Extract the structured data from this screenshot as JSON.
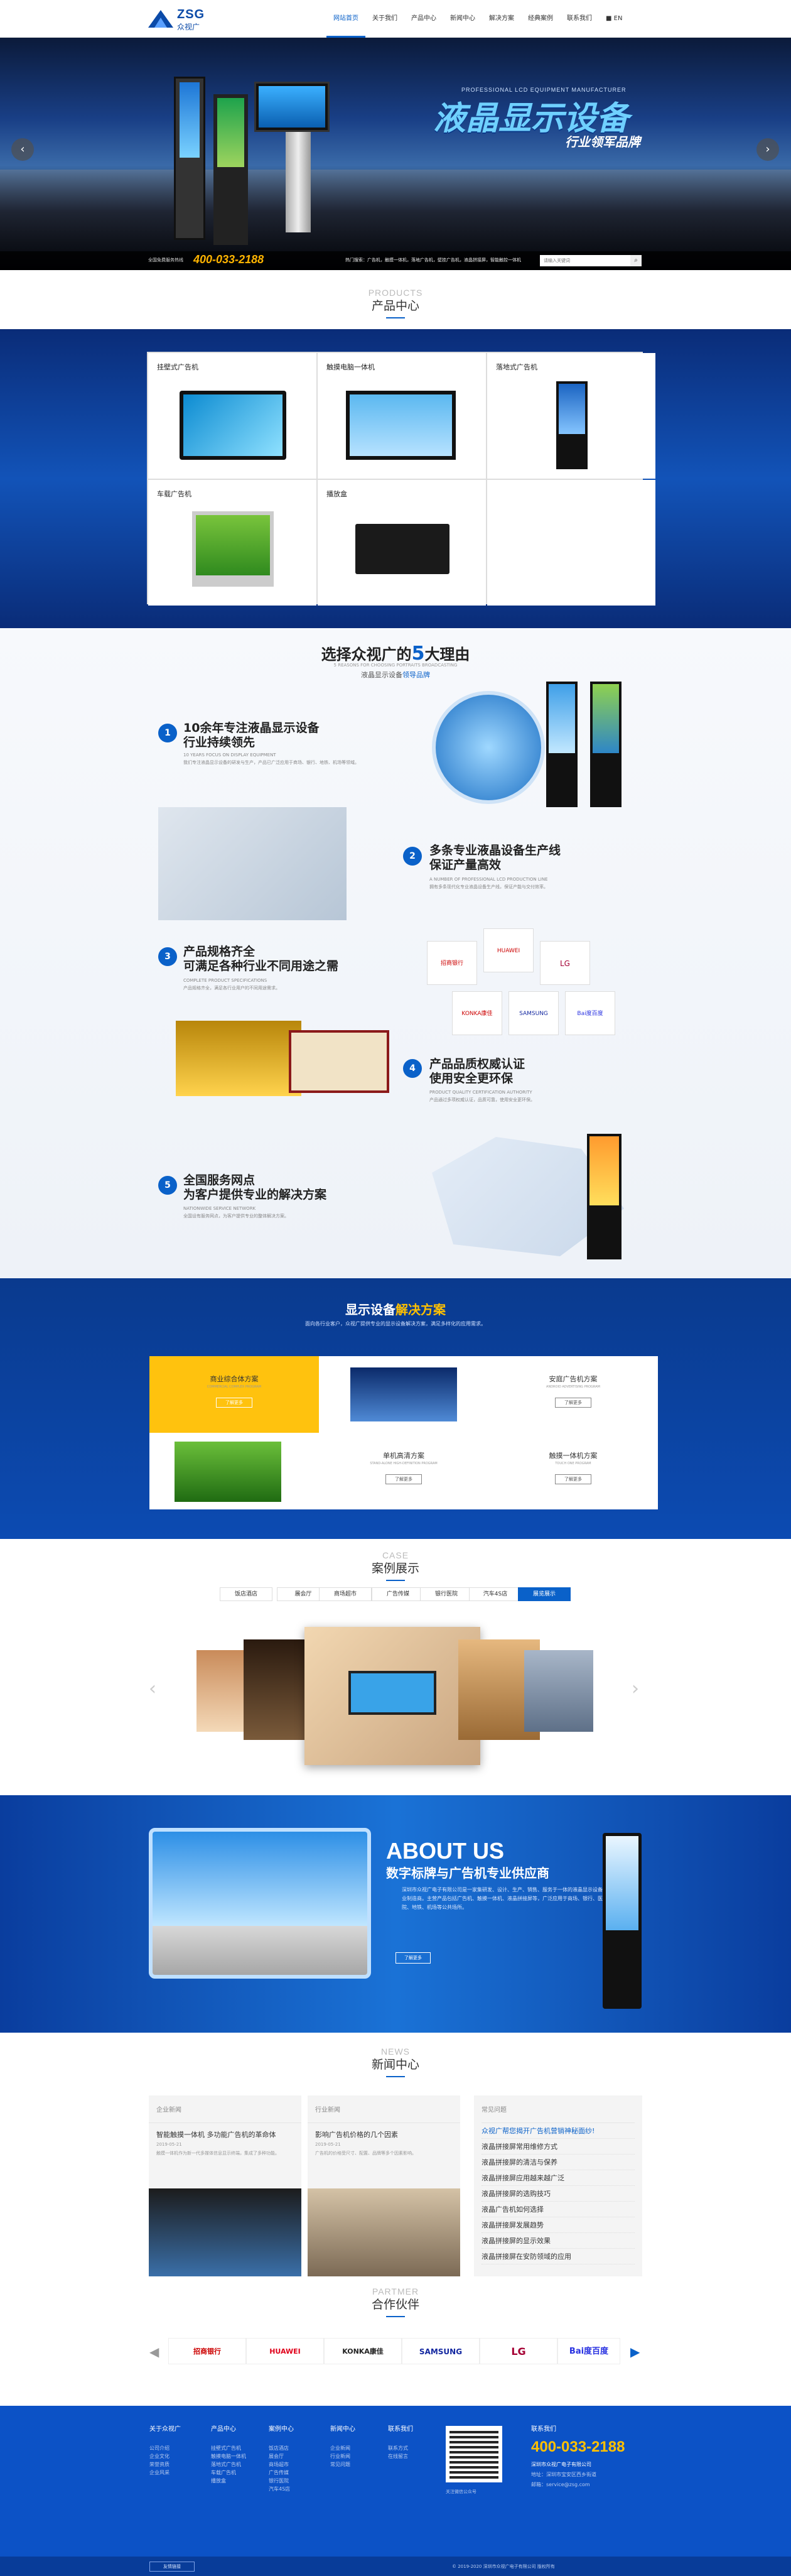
{
  "header": {
    "logo_main": "ZSG",
    "logo_sub": "众视广",
    "nav": [
      "网站首页",
      "关于我们",
      "产品中心",
      "新闻中心",
      "解决方案",
      "经典案例",
      "联系我们",
      "■ EN"
    ]
  },
  "banner": {
    "tag_en": "PROFESSIONAL LCD EQUIPMENT MANUFACTURER",
    "title": "液晶显示设备",
    "subtitle": "行业领军品牌",
    "hotline_label": "全国免费服务热线",
    "hotline": "400-033-2188",
    "hot_words": "热门搜索：广告机，触摸一体机，落地广告机，壁挂广告机，液晶拼接屏，智能触控一体机",
    "search_placeholder": "请输入关键词"
  },
  "products": {
    "en": "PRODUCTS",
    "cn": "产品中心",
    "items": [
      "挂壁式广告机",
      "触摸电脑一体机",
      "落地式广告机",
      "车载广告机",
      "播放盒"
    ]
  },
  "reasons": {
    "title_a": "选择众视广的",
    "title_num": "5",
    "title_b": "大理由",
    "sub_en": "5 REASONS FOR CHOOSING PORTRAITS BROADCASTING",
    "sub_cn_a": "液晶显示设备",
    "sub_cn_b": "领导品牌",
    "items": [
      {
        "n": "1",
        "t1": "10余年专注液晶显示设备",
        "t2": "行业持续领先",
        "en": "10 YEARS FOCUS ON DISPLAY EQUIPMENT",
        "d": "我们专注液晶显示设备的研发与生产，产品已广泛应用于商场、银行、地铁、机场等领域。"
      },
      {
        "n": "2",
        "t1": "多条专业液晶设备生产线",
        "t2": "保证产量高效",
        "en": "A NUMBER OF PROFESSIONAL LCD PRODUCTION LINE",
        "d": "拥有多条现代化专业液晶设备生产线，保证产能与交付效率。"
      },
      {
        "n": "3",
        "t1": "产品规格齐全",
        "t2": "可满足各种行业不同用途之需",
        "en": "COMPLETE PRODUCT SPECIFICATIONS",
        "d": "产品规格齐全，满足各行业用户的不同用途需求。"
      },
      {
        "n": "4",
        "t1": "产品品质权威认证",
        "t2": "使用安全更环保",
        "en": "PRODUCT QUALITY CERTIFICATION AUTHORITY",
        "d": "产品通过多项权威认证，品质可靠，使用安全更环保。"
      },
      {
        "n": "5",
        "t1": "全国服务网点",
        "t2": "为客户提供专业的解决方案",
        "en": "NATIONWIDE SERVICE NETWORK",
        "d": "全国设有服务网点，为客户提供专业的整体解决方案。"
      }
    ],
    "brands": [
      "招商银行",
      "HUAWEI",
      "LG",
      "KONKA康佳",
      "SAMSUNG",
      "Bai度百度"
    ]
  },
  "solutions": {
    "title_a": "显示设备",
    "title_b": "解决方案",
    "desc": "面向各行业客户，众视广提供专业的显示设备解决方案，满足多样化的应用需求。",
    "items": [
      {
        "t": "商业综合体方案",
        "e": "COMMERCIAL COMPLEX PROGRAM",
        "b": "了解更多"
      },
      {
        "t": "安庭广告机方案",
        "e": "ANDROID ADVERTISING PROGRAM",
        "b": "了解更多"
      },
      {
        "t": "单机高清方案",
        "e": "STAND-ALONE HIGH-DEFINITION PROGRAM",
        "b": "了解更多"
      },
      {
        "t": "触摸一体机方案",
        "e": "TOUCH ONE PROGRAM",
        "b": "了解更多"
      }
    ]
  },
  "cases": {
    "en": "CASE",
    "cn": "案例展示",
    "tabs": [
      "饭店酒店",
      "展会厅",
      "商场超市",
      "广告传媒",
      "银行医院",
      "汽车4S店",
      "展览展示"
    ],
    "active": 6
  },
  "about": {
    "title": "ABOUT US",
    "subtitle": "数字标牌与广告机专业供应商",
    "desc": "深圳市众视广电子有限公司是一家集研发、设计、生产、销售、服务于一体的液晶显示设备专业制造商。主营产品包括广告机、触摸一体机、液晶拼接屏等，广泛应用于商场、银行、医院、地铁、机场等公共场所。",
    "more": "了解更多"
  },
  "news": {
    "en": "NEWS",
    "cn": "新闻中心",
    "c1": {
      "cat": "企业新闻",
      "title": "智能触摸一体机 多功能广告机的革命体",
      "date": "2019-05-21",
      "desc": "触摸一体机作为新一代多媒体信息显示终端，集成了多种功能。"
    },
    "c2": {
      "cat": "行业新闻",
      "title": "影响广告机价格的几个因素",
      "date": "2019-05-21",
      "desc": "广告机的价格受尺寸、配置、品牌等多个因素影响。"
    },
    "c3": {
      "cat": "常见问题",
      "items": [
        "众视广帮您揭开广告机营销神秘面纱!",
        "液晶拼接屏常用维修方式",
        "液晶拼接屏的清洁与保养",
        "液晶拼接屏应用越来越广泛",
        "液晶拼接屏的选购技巧",
        "液晶广告机如何选择",
        "液晶拼接屏发展趋势",
        "液晶拼接屏的显示效果",
        "液晶拼接屏在安防领域的应用"
      ]
    }
  },
  "partners": {
    "en": "PARTMER",
    "cn": "合作伙伴",
    "logos": [
      "招商银行",
      "HUAWEI",
      "KONKA康佳",
      "SAMSUNG",
      "LG",
      "Bai度百度"
    ]
  },
  "footer": {
    "cols": [
      {
        "h": "关于众视广",
        "items": [
          "公司介绍",
          "企业文化",
          "荣誉资质",
          "企业风采"
        ]
      },
      {
        "h": "产品中心",
        "items": [
          "挂壁式广告机",
          "触摸电脑一体机",
          "落地式广告机",
          "车载广告机",
          "播放盒"
        ]
      },
      {
        "h": "案例中心",
        "items": [
          "饭店酒店",
          "展会厅",
          "商场超市",
          "广告传媒",
          "银行医院",
          "汽车4S店"
        ]
      },
      {
        "h": "新闻中心",
        "items": [
          "企业新闻",
          "行业新闻",
          "常见问题"
        ]
      },
      {
        "h": "联系我们",
        "items": [
          "联系方式",
          "在线留言"
        ]
      }
    ],
    "qr_label": "关注微信公众号",
    "contact_h": "联系我们",
    "phone": "400-033-2188",
    "company": "深圳市众视广电子有限公司",
    "addr": "地址：深圳市宝安区西乡街道",
    "email": "邮箱：service@zsg.com",
    "copyright": "© 2019-2020 深圳市众视广电子有限公司 版权所有",
    "link_btn": "友情链接"
  }
}
